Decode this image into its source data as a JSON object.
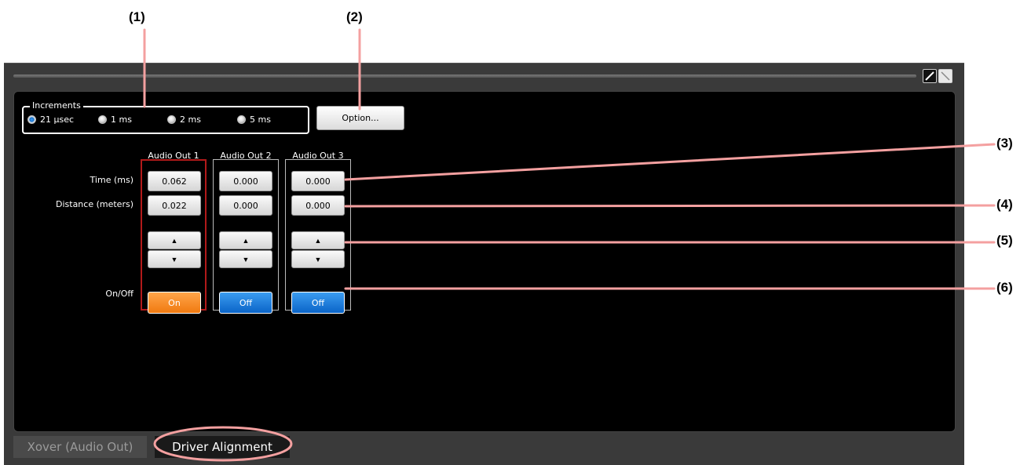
{
  "callouts": [
    "(1)",
    "(2)",
    "(3)",
    "(4)",
    "(5)",
    "(6)"
  ],
  "increments": {
    "legend": "Increments",
    "options": [
      "21 μsec",
      "1 ms",
      "2 ms",
      "5 ms"
    ],
    "selected": "21 μsec"
  },
  "option_button": "Option...",
  "row_labels": {
    "time": "Time (ms)",
    "distance": "Distance (meters)",
    "onoff": "On/Off"
  },
  "outputs": [
    {
      "name": "Audio Out 1",
      "time": "0.062",
      "distance": "0.022",
      "state": "On"
    },
    {
      "name": "Audio Out 2",
      "time": "0.000",
      "distance": "0.000",
      "state": "Off"
    },
    {
      "name": "Audio Out 3",
      "time": "0.000",
      "distance": "0.000",
      "state": "Off"
    }
  ],
  "arrows": {
    "up": "▲",
    "down": "▼"
  },
  "tabs": [
    "Xover (Audio Out)",
    "Driver Alignment"
  ],
  "active_tab": "Driver Alignment",
  "colors": {
    "on_button": "#f07a10",
    "off_button": "#0a64c8",
    "callout_line": "#f4a0a0",
    "active_column_border": "#b21a1a"
  },
  "icons": [
    "edit-pencil-icon",
    "diagonal-resize-icon",
    "radio-icon",
    "arrow-up-icon",
    "arrow-down-icon"
  ]
}
